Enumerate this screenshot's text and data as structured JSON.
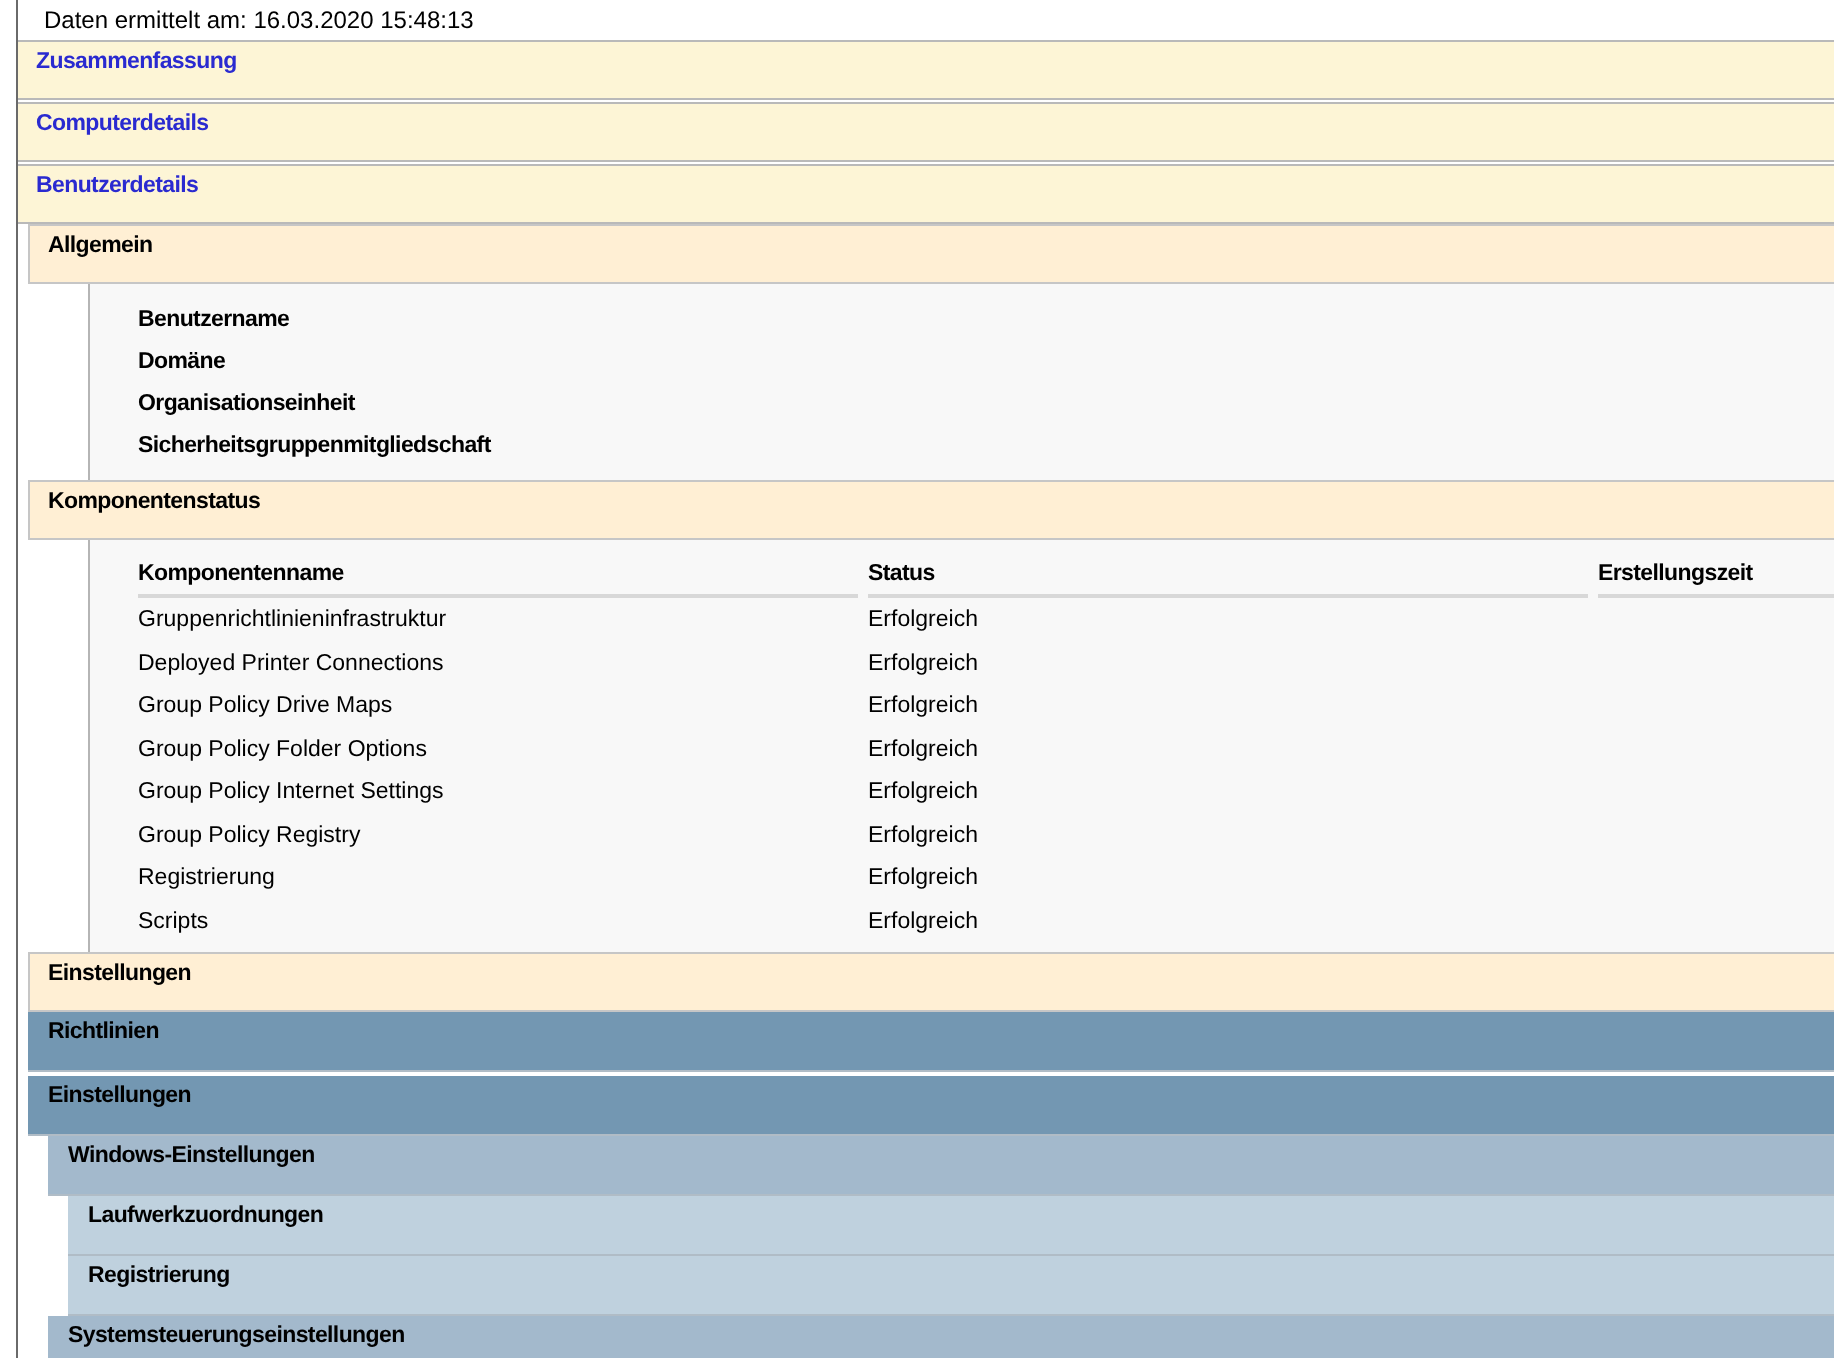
{
  "header": "Daten ermittelt am: 16.03.2020 15:48:13",
  "sections": [
    {
      "title": "Zusammenfassung"
    },
    {
      "title": "Computerdetails"
    },
    {
      "title": "Benutzerdetails"
    }
  ],
  "general": {
    "title": "Allgemein",
    "fields": [
      "Benutzername",
      "Domäne",
      "Organisationseinheit",
      "Sicherheitsgruppenmitgliedschaft"
    ]
  },
  "components": {
    "title": "Komponentenstatus",
    "columns": [
      "Komponentenname",
      "Status",
      "Erstellungszeit"
    ],
    "rows": [
      [
        "Gruppenrichtlinieninfrastruktur",
        "Erfolgreich"
      ],
      [
        "Deployed Printer Connections",
        "Erfolgreich"
      ],
      [
        "Group Policy Drive Maps",
        "Erfolgreich"
      ],
      [
        "Group Policy Folder Options",
        "Erfolgreich"
      ],
      [
        "Group Policy Internet Settings",
        "Erfolgreich"
      ],
      [
        "Group Policy Registry",
        "Erfolgreich"
      ],
      [
        "Registrierung",
        "Erfolgreich"
      ],
      [
        "Scripts",
        "Erfolgreich"
      ]
    ]
  },
  "settings": {
    "title": "Einstellungen",
    "children": [
      {
        "title": "Richtlinien"
      },
      {
        "title": "Einstellungen",
        "children": [
          {
            "title": "Windows-Einstellungen",
            "children": [
              {
                "title": "Laufwerkzuordnungen"
              },
              {
                "title": "Registrierung"
              }
            ]
          },
          {
            "title": "Systemsteuerungseinstellungen"
          }
        ]
      }
    ]
  }
}
